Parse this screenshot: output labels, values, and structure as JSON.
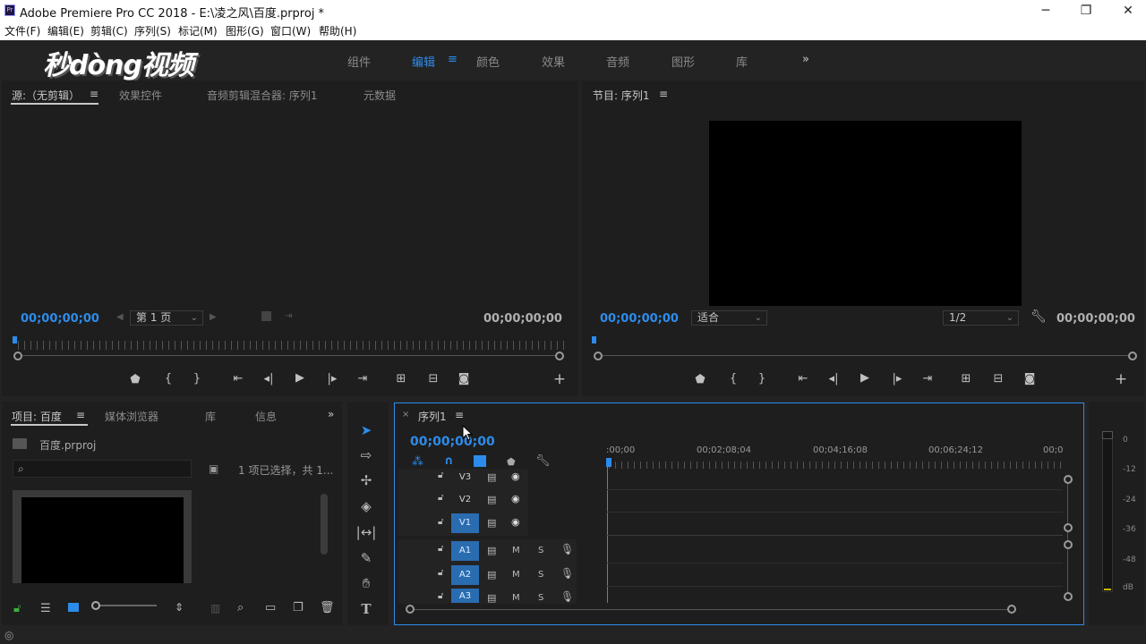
{
  "titlebar": {
    "app_title": "Adobe Premiere Pro CC 2018 - E:\\凌之风\\百度.prproj *",
    "logo": "Pr",
    "minimize": "─",
    "restore": "❐",
    "close": "✕"
  },
  "menu": [
    "文件(F)",
    "编辑(E)",
    "剪辑(C)",
    "序列(S)",
    "标记(M)",
    "图形(G)",
    "窗口(W)",
    "帮助(H)"
  ],
  "watermark": "秒dòng视频",
  "workspaces": {
    "items": [
      "组件",
      "编辑",
      "颜色",
      "效果",
      "音频",
      "图形",
      "库"
    ],
    "active_index": 1,
    "more": "»"
  },
  "source_panel": {
    "tabs": [
      "源:（无剪辑）",
      "效果控件",
      "音频剪辑混合器: 序列1",
      "元数据"
    ],
    "timecode_in": "00;00;00;00",
    "timecode_out": "00;00;00;00",
    "page_select": "第 1 页"
  },
  "program_panel": {
    "tab": "节目: 序列1",
    "timecode_in": "00;00;00;00",
    "timecode_out": "00;00;00;00",
    "fit_select": "适合",
    "resolution_select": "1/2"
  },
  "project_panel": {
    "tabs": [
      "项目: 百度",
      "媒体浏览器",
      "库",
      "信息"
    ],
    "more": "»",
    "file": "百度.prproj",
    "status": "1 项已选择，共 1..."
  },
  "timeline": {
    "close": "×",
    "tab": "序列1",
    "timecode": "00;00;00;00",
    "ruler_labels": [
      ":00;00",
      "00;02;08;04",
      "00;04;16;08",
      "00;06;24;12",
      "00;0"
    ],
    "video_tracks": [
      "V3",
      "V2",
      "V1"
    ],
    "audio_tracks": [
      "A1",
      "A2",
      "A3"
    ],
    "mute": "M",
    "solo": "S"
  },
  "audio_meter": {
    "labels": [
      "0",
      "-12",
      "-24",
      "-36",
      "-48",
      "dB"
    ]
  },
  "colors": {
    "accent": "#2d8ceb",
    "track_target": "#2a6cb0",
    "panel_bg": "#1e1e1e"
  },
  "icons": {
    "menu": "≡",
    "add": "+",
    "play": "▶"
  }
}
